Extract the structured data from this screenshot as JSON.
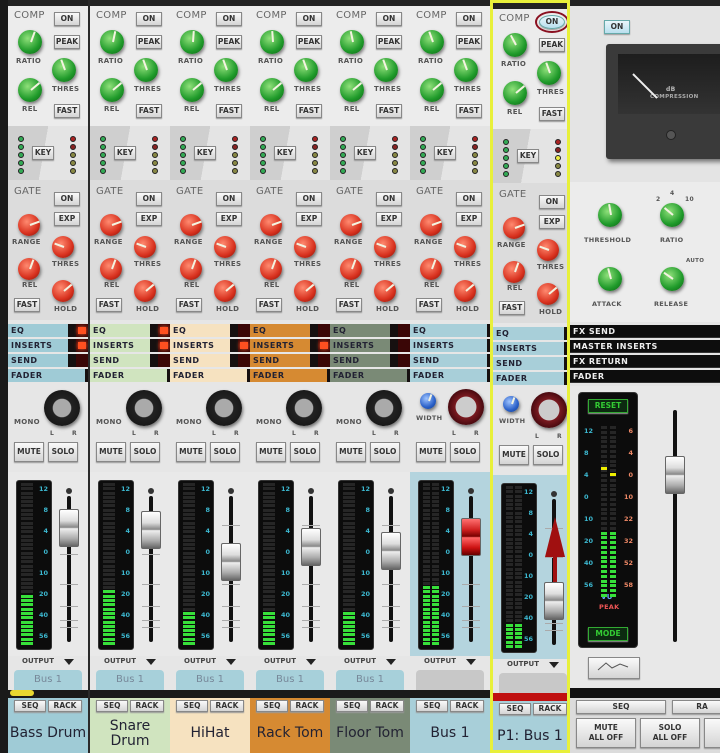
{
  "labels": {
    "comp": "COMP",
    "on": "ON",
    "peak": "PEAK",
    "ratio": "RATIO",
    "thres": "THRES",
    "rel": "REL",
    "fast": "FAST",
    "key": "KEY",
    "gate": "GATE",
    "exp": "EXP",
    "range": "RANGE",
    "hold": "HOLD",
    "eq": "EQ",
    "inserts": "INSERTS",
    "send": "SEND",
    "fader": "FADER",
    "mono": "MONO",
    "width": "WIDTH",
    "l": "L",
    "r": "R",
    "mute": "MUTE",
    "solo": "SOLO",
    "output": "OUTPUT",
    "seq": "SEQ",
    "rack": "RACK"
  },
  "meter_scale": [
    "12",
    "8",
    "4",
    "0",
    "10",
    "20",
    "40",
    "56"
  ],
  "channels": [
    {
      "name": "Bass Drum",
      "color": "#9fcbd6",
      "output": "Bus 1",
      "type": "mono",
      "eq_led": true,
      "inserts_led": true,
      "send_led": false,
      "fader_level": 0.78,
      "meter_level": 0.3,
      "gate_on": false
    },
    {
      "name": "Snare Drum",
      "color": "#d0e4bf",
      "output": "Bus 1",
      "type": "mono",
      "eq_led": true,
      "inserts_led": true,
      "send_led": false,
      "fader_level": 0.77,
      "meter_level": 0.32,
      "gate_on": true
    },
    {
      "name": "HiHat",
      "color": "#f6e2c0",
      "output": "Bus 1",
      "type": "mono",
      "eq_led": false,
      "inserts_led": true,
      "send_led": false,
      "fader_level": 0.55,
      "meter_level": 0.2,
      "gate_on": false
    },
    {
      "name": "Rack Tom",
      "color": "#d68a32",
      "output": "Bus 1",
      "type": "mono",
      "eq_led": false,
      "inserts_led": true,
      "send_led": false,
      "fader_level": 0.65,
      "meter_level": 0.2,
      "gate_on": true
    },
    {
      "name": "Floor Tom",
      "color": "#7a8a76",
      "output": "Bus 1",
      "type": "mono",
      "eq_led": false,
      "inserts_led": false,
      "send_led": false,
      "fader_level": 0.62,
      "meter_level": 0.2,
      "gate_on": true
    },
    {
      "name": "Bus 1",
      "color": "#a8cfd9",
      "output": "",
      "type": "bus",
      "eq_led": false,
      "inserts_led": false,
      "send_led": false,
      "fader_level": 0.72,
      "meter_level": 0.36,
      "gate_on": true,
      "red_fader": true
    },
    {
      "name": "P1: Bus 1",
      "color": "#a8cfd9",
      "output": "",
      "type": "bus",
      "eq_led": false,
      "inserts_led": false,
      "send_led": false,
      "fader_level": 0.3,
      "meter_level": 0.15,
      "gate_on": true,
      "selected": true,
      "comp_on_active": true
    }
  ],
  "master": {
    "on": "ON",
    "vu_label": "dB",
    "vu_sub": "COMPRESSION",
    "threshold": "THRESHOLD",
    "ratio": "RATIO",
    "attack": "ATTACK",
    "release": "RELEASE",
    "auto": "AUTO",
    "ratio_marks": [
      "2",
      "4",
      "10"
    ],
    "sections": [
      "FX SEND",
      "MASTER INSERTS",
      "FX RETURN",
      "FADER"
    ],
    "reset": "RESET",
    "mode": "MODE",
    "vu": "VU",
    "peak": "PEAK",
    "scale_left": [
      "12",
      "8",
      "4",
      "0",
      "10",
      "20",
      "40",
      "56"
    ],
    "scale_right": [
      "6",
      "4",
      "0",
      "10",
      "22",
      "32",
      "52",
      "58"
    ],
    "fader_level": 0.72,
    "meter_level": 0.38,
    "seq": "SEQ",
    "rack": "RA",
    "mute_all": "MUTE\nALL OFF",
    "solo_all": "SOLO\nALL OFF"
  }
}
